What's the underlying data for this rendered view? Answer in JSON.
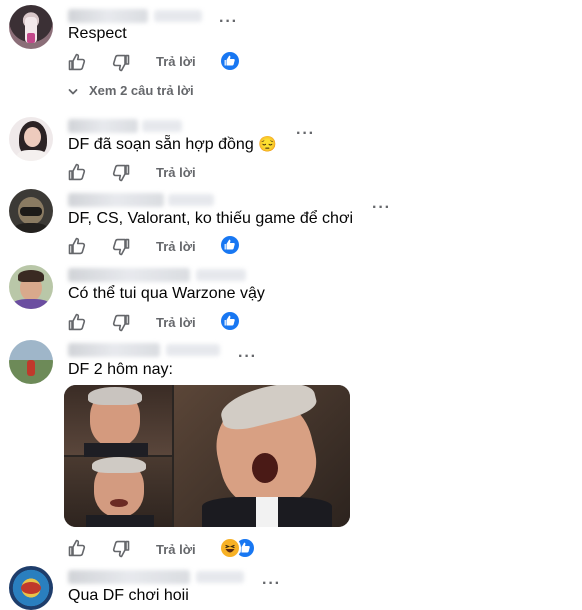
{
  "actions": {
    "reply_label": "Trả lời"
  },
  "comments": [
    {
      "text": "Respect",
      "reactions": [
        "like"
      ]
    },
    {
      "text": "DF đã soạn sẵn hợp đồng",
      "emoji": "😔",
      "reactions": []
    },
    {
      "text": "DF, CS, Valorant, ko thiếu game để chơi",
      "reactions": [
        "like"
      ]
    },
    {
      "text": "Có thể tui qua Warzone vậy",
      "reactions": [
        "like"
      ]
    },
    {
      "text": "DF 2 hôm nay:",
      "reactions": [
        "haha",
        "like"
      ],
      "has_image": true
    },
    {
      "text": "Qua DF chơi hoii",
      "reactions": []
    }
  ],
  "replies_toggle": {
    "label": "Xem 2 câu trả lời"
  },
  "colors": {
    "accent": "#1877f2",
    "secondary_text": "#65676b",
    "haha": "#f7b125"
  },
  "icons": [
    "thumbs-up-icon",
    "thumbs-down-icon",
    "more-options-icon",
    "chevron-down-icon",
    "like-reaction-icon",
    "haha-reaction-icon"
  ]
}
